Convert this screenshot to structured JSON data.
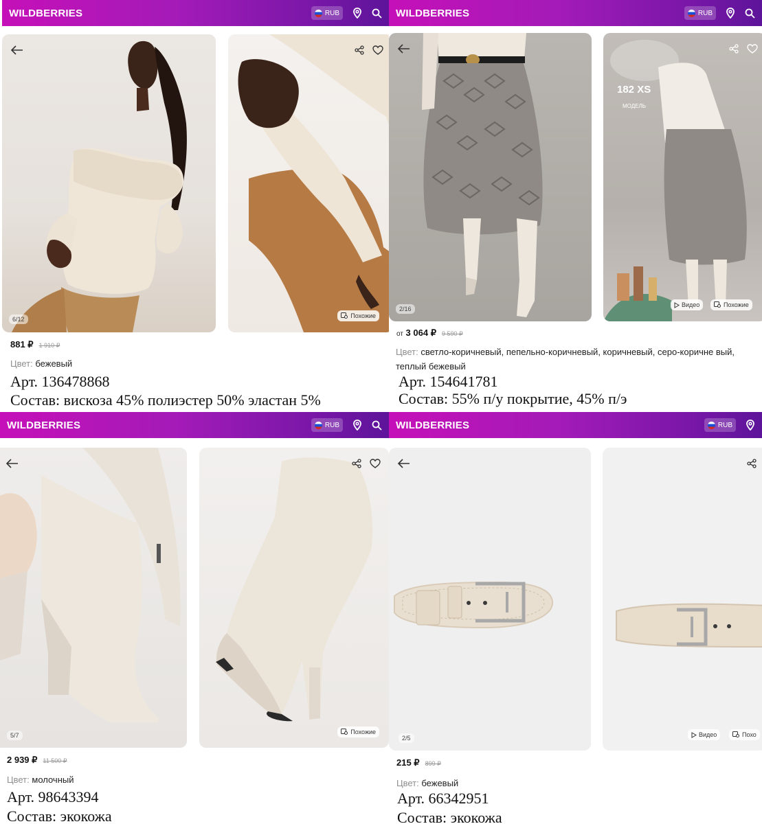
{
  "brand": "WILDBERRIES",
  "currency": "RUB",
  "panels": [
    {
      "counter": "6/12",
      "similar": "Похожие",
      "price": "881 ₽",
      "old_price": "1 910 ₽",
      "color_label": "Цвет:",
      "color_value": "бежевый",
      "article": "Арт. 136478868",
      "composition": "Состав: вискоза 45% полиэстер 50% эластан 5%"
    },
    {
      "counter": "2/16",
      "model_size": "182 XS",
      "model_label": "МОДЕЛЬ",
      "video": "Видео",
      "similar": "Похожие",
      "price_prefix": "от",
      "price": "3 064 ₽",
      "old_price": "9 590 ₽",
      "color_label": "Цвет:",
      "color_value": "светло-коричневый, пепельно-коричневый, коричневый, серо-коричне вый, теплый бежевый",
      "article": "Арт. 154641781",
      "composition": "Состав: 55% п/у покрытие, 45% п/э"
    },
    {
      "counter": "5/7",
      "similar": "Похожие",
      "price": "2 939 ₽",
      "old_price": "11 500 ₽",
      "color_label": "Цвет:",
      "color_value": "молочный",
      "article": "Арт. 98643394",
      "composition": "Состав: экокожа"
    },
    {
      "counter": "2/5",
      "video": "Видео",
      "similar": "Похо",
      "price": "215 ₽",
      "old_price": "899 ₽",
      "color_label": "Цвет:",
      "color_value": "бежевый",
      "article": "Арт. 66342951",
      "composition": "Состав: экокожа"
    }
  ],
  "icons": [
    "back-arrow-icon",
    "share-icon",
    "heart-icon",
    "location-pin-icon",
    "search-icon",
    "similar-icon",
    "play-icon",
    "flag-ru-icon"
  ],
  "colors": {
    "brand_start": "#c510b8",
    "brand_end": "#5d149a",
    "text": "#111111",
    "muted": "#8e8e8e"
  }
}
